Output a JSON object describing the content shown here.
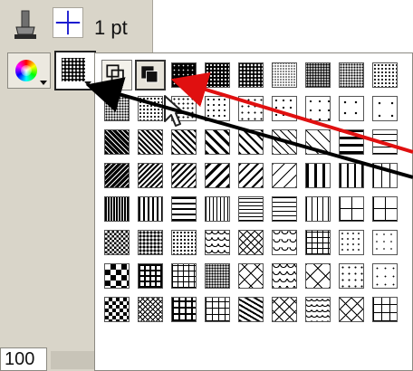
{
  "toolbar": {
    "brush_icon": "brush-icon",
    "stroke_icon": "crosshair-icon",
    "stroke_weight": "1 pt"
  },
  "color_button": {
    "icon": "color-wheel-icon"
  },
  "pattern_button": {
    "icon": "pattern-swatch-icon"
  },
  "zoom": {
    "value": "100"
  },
  "palette": {
    "mode_buttons": [
      "outline-mode",
      "filled-mode"
    ],
    "selected_mode": "filled-mode",
    "swatch_rows": 8,
    "swatch_columns": 9
  },
  "annotations": {
    "red_arrow": "#e01010",
    "black_arrow": "#000000"
  },
  "colors": {
    "panel_bg": "#d9d5c9",
    "palette_bg": "#ffffff",
    "accent_blue": "#1a1ad0"
  }
}
